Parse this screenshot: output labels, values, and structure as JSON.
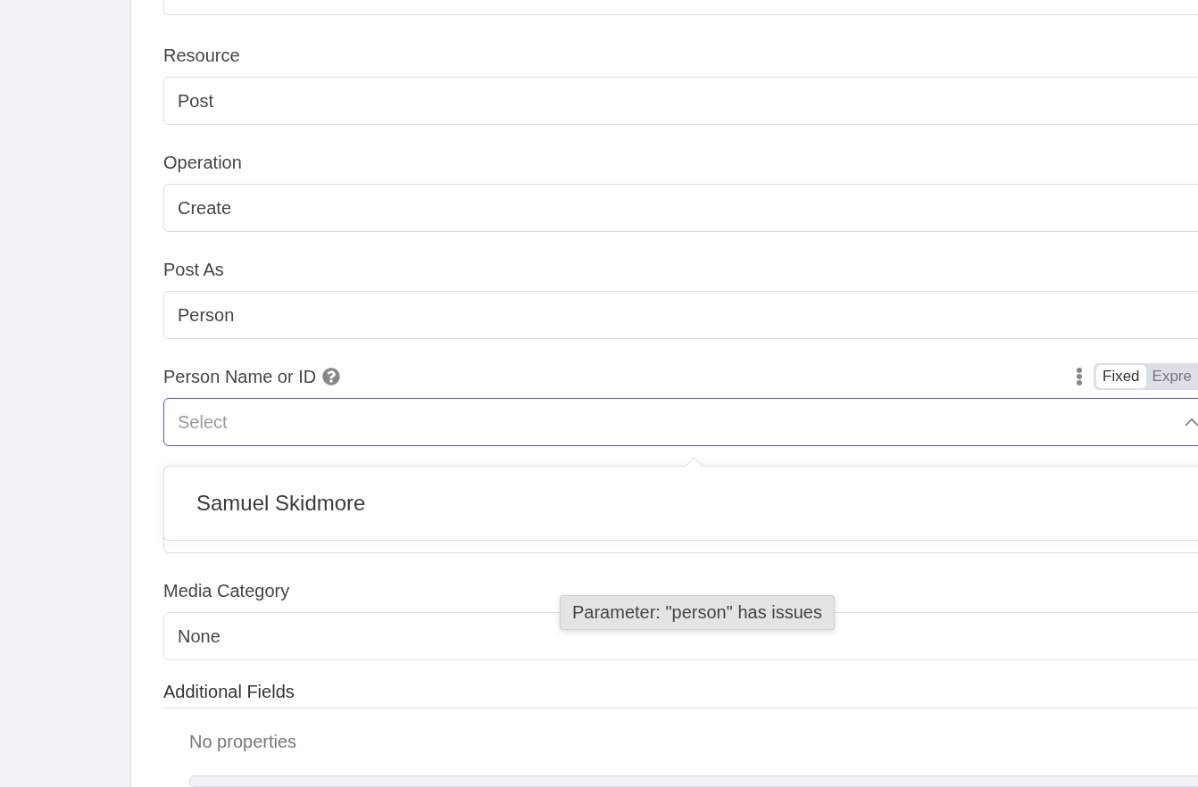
{
  "fields": [
    {
      "kind": "select",
      "label": "Resource",
      "value": "Post"
    },
    {
      "kind": "select",
      "label": "Operation",
      "value": "Create"
    },
    {
      "kind": "select",
      "label": "Post As",
      "value": "Person"
    },
    {
      "kind": "combo",
      "label": "Person Name or ID",
      "placeholder": "Select",
      "focused": true,
      "expanded": true,
      "mode_toggle": [
        {
          "label": "Fixed",
          "selected": true
        },
        {
          "label": "Expre",
          "selected": false
        }
      ],
      "options": [
        {
          "label": "Samuel Skidmore"
        }
      ]
    },
    {
      "kind": "hidden"
    },
    {
      "kind": "select",
      "label": "Media Category",
      "value": "None"
    }
  ],
  "additional_fields": {
    "title": "Additional Fields",
    "empty_text": "No properties"
  },
  "tooltip": "Parameter: \"person\" has issues"
}
